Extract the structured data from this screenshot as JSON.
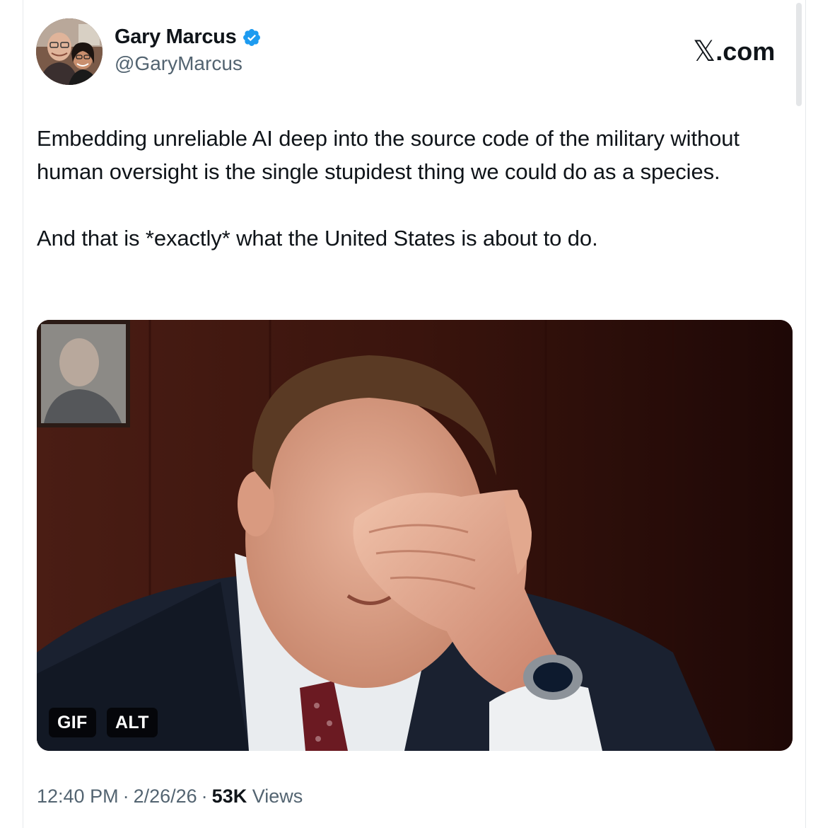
{
  "author": {
    "display_name": "Gary Marcus",
    "handle": "@GaryMarcus",
    "verified": true,
    "verified_color": "#1d9bf0"
  },
  "brand": {
    "logo_text": ".com",
    "logo_mark": "𝕏"
  },
  "tweet": {
    "paragraphs": [
      "Embedding unreliable AI deep into the source code of the military without human oversight is the single stupidest thing we could do as a species.",
      "And that is *exactly* what the United States is about to do."
    ]
  },
  "media": {
    "type": "gif",
    "badges": {
      "gif": "GIF",
      "alt": "ALT"
    }
  },
  "meta": {
    "time": "12:40 PM",
    "separator": "·",
    "date": "2/26/26",
    "views_count": "53K",
    "views_label": "Views"
  },
  "colors": {
    "text_primary": "#0f1419",
    "text_secondary": "#536471",
    "accent": "#1d9bf0"
  }
}
